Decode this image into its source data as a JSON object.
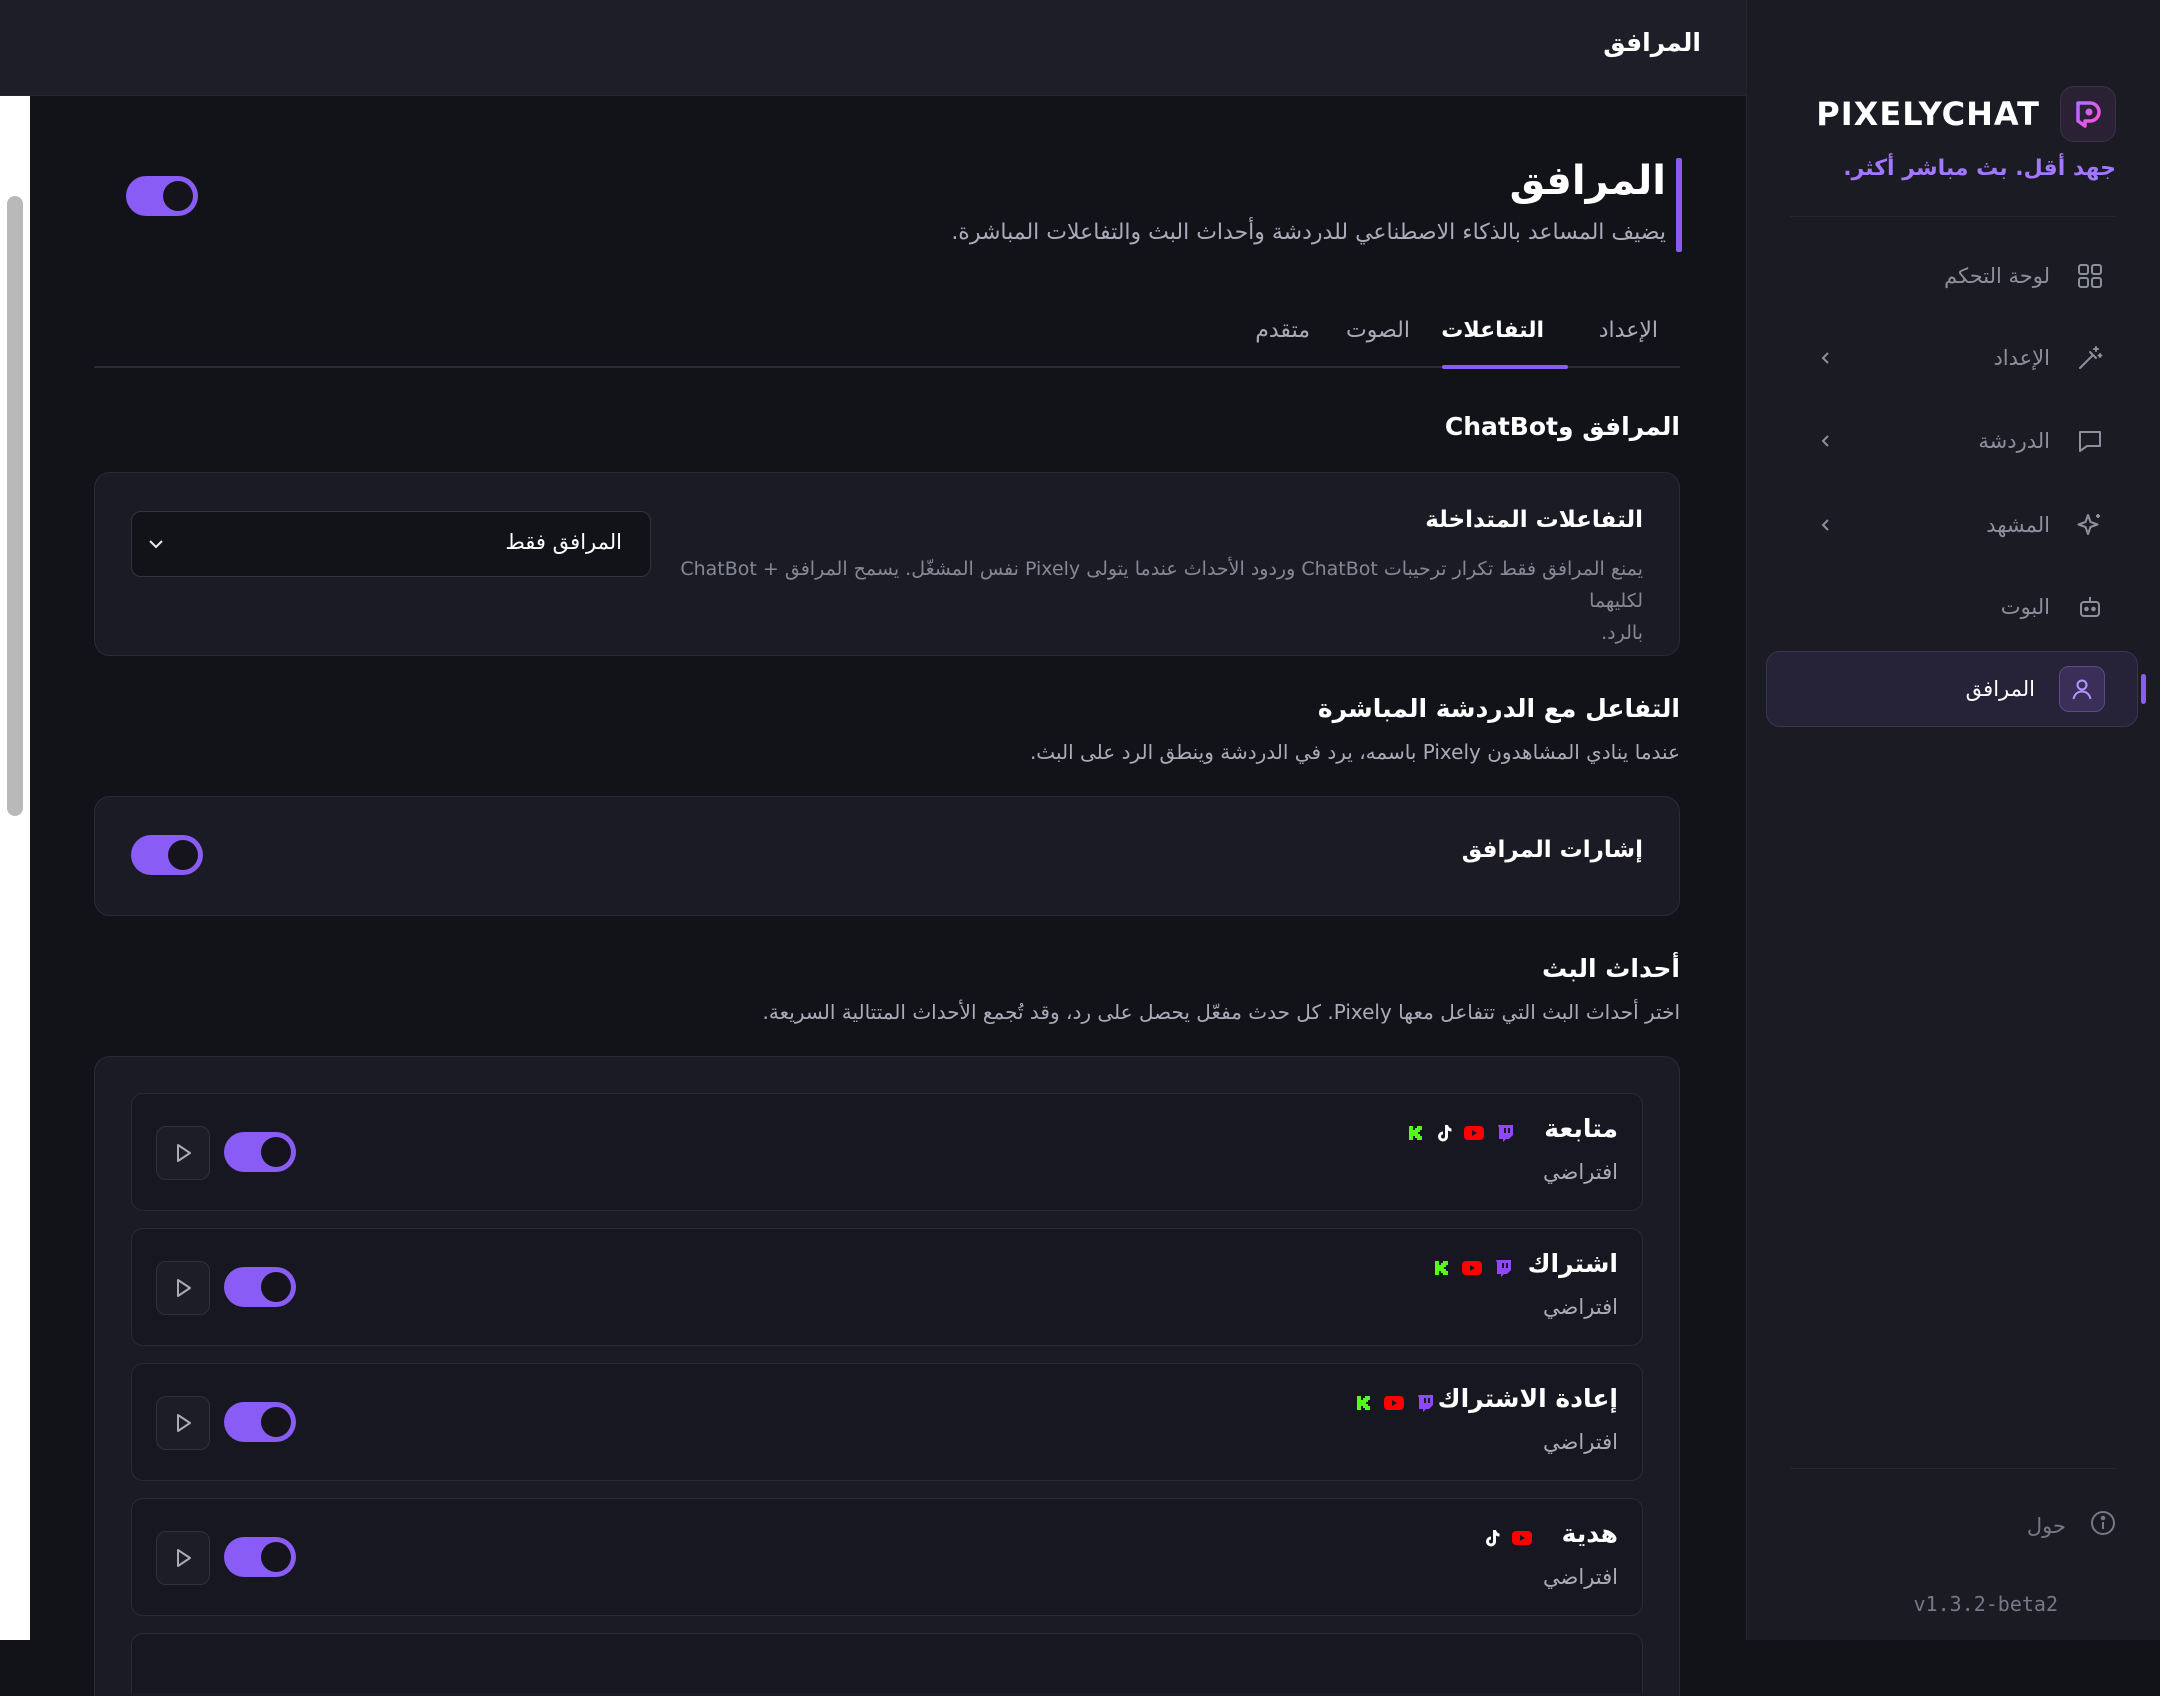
{
  "app": {
    "brand": "PIXELYCHAT",
    "tagline": "جهد أقل. بث مباشر أكثر.",
    "accent": "#8a5cf6",
    "version": "v1.3.2-beta2"
  },
  "header": {
    "title": "المرافق"
  },
  "sidebar": {
    "items": [
      {
        "label": "لوحة التحكم",
        "icon": "grid-icon"
      },
      {
        "label": "الإعداد",
        "icon": "wand-icon",
        "expandable": true
      },
      {
        "label": "الدردشة",
        "icon": "message-icon",
        "expandable": true
      },
      {
        "label": "المشهد",
        "icon": "sparkle-icon",
        "expandable": true
      },
      {
        "label": "البوت",
        "icon": "bot-icon"
      },
      {
        "label": "المرافق",
        "icon": "user-icon",
        "active": true
      }
    ],
    "about_label": "حول"
  },
  "page": {
    "title": "المرافق",
    "subtitle": "يضيف المساعد بالذكاء الاصطناعي للدردشة وأحداث البث والتفاعلات المباشرة.",
    "enabled": true,
    "tabs": [
      {
        "label": "الإعداد"
      },
      {
        "label": "التفاعلات",
        "active": true
      },
      {
        "label": "الصوت"
      },
      {
        "label": "متقدم"
      }
    ]
  },
  "sections": {
    "companion_chatbot": {
      "title": "المرافق وChatBot",
      "overlap": {
        "title": "التفاعلات المتداخلة",
        "desc_line1": "يمنع المرافق فقط تكرار ترحيبات ChatBot وردود الأحداث عندما يتولى Pixely نفس المشغّل. يسمح المرافق + ChatBot لكليهما",
        "desc_line2": "بالرد.",
        "selected": "المرافق فقط"
      }
    },
    "live_chat": {
      "title": "التفاعل مع الدردشة المباشرة",
      "subtitle": "عندما ينادي المشاهدون Pixely باسمه، يرد في الدردشة وينطق الرد على البث.",
      "mentions": {
        "label": "إشارات المرافق",
        "enabled": true
      }
    },
    "stream_events": {
      "title": "أحداث البث",
      "subtitle": "اختر أحداث البث التي تتفاعل معها Pixely. كل حدث مفعّل يحصل على رد، وقد تُجمع الأحداث المتتالية السريعة.",
      "events": [
        {
          "name": "متابعة",
          "sub": "افتراضي",
          "enabled": true,
          "platforms": [
            "twitch-icon",
            "youtube-icon",
            "tiktok-icon",
            "kick-icon"
          ]
        },
        {
          "name": "اشتراك",
          "sub": "افتراضي",
          "enabled": true,
          "platforms": [
            "twitch-icon",
            "youtube-icon",
            "kick-icon"
          ]
        },
        {
          "name": "إعادة الاشتراك",
          "sub": "افتراضي",
          "enabled": true,
          "platforms": [
            "twitch-icon",
            "youtube-icon",
            "kick-icon"
          ]
        },
        {
          "name": "هدية",
          "sub": "افتراضي",
          "enabled": true,
          "platforms": [
            "youtube-icon",
            "tiktok-icon"
          ]
        }
      ]
    }
  },
  "colors": {
    "twitch": "#9146ff",
    "youtube": "#ff0000",
    "kick": "#53fc18",
    "tiktok": "#ffffff"
  }
}
